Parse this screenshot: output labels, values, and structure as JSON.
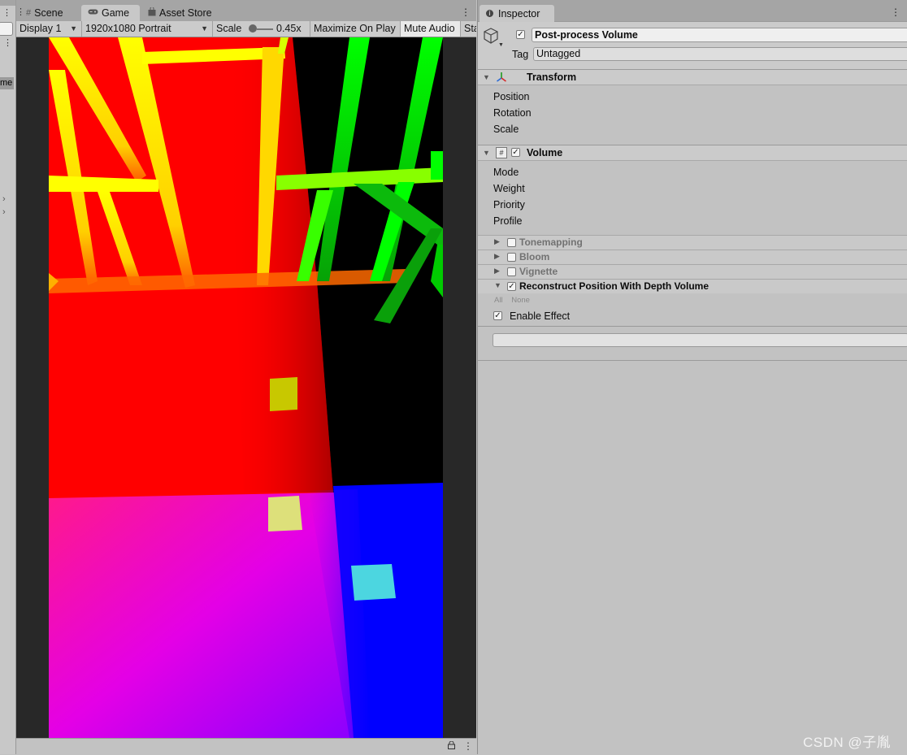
{
  "left_panel": {
    "partial_label": "me"
  },
  "game_window": {
    "tabs": [
      {
        "label": "Scene",
        "icon": "grid-icon",
        "active": false
      },
      {
        "label": "Game",
        "icon": "gamepad-icon",
        "active": true
      },
      {
        "label": "Asset Store",
        "icon": "shopping-bag-icon",
        "active": false
      }
    ],
    "toolbar": {
      "display": "Display 1",
      "resolution": "1920x1080 Portrait",
      "scale_label": "Scale",
      "scale_value": "0.45x",
      "maximize_on_play": "Maximize On Play",
      "mute_audio": "Mute Audio",
      "stats_partial": "Sta"
    }
  },
  "inspector": {
    "tab_label": "Inspector",
    "game_object": {
      "active": true,
      "name": "Post-process Volume",
      "tag_label": "Tag",
      "tag_value": "Untagged"
    },
    "transform": {
      "title": "Transform",
      "properties": [
        "Position",
        "Rotation",
        "Scale"
      ]
    },
    "volume": {
      "enabled": true,
      "title": "Volume",
      "properties": [
        "Mode",
        "Weight",
        "Priority",
        "Profile"
      ]
    },
    "effects": [
      {
        "label": "Tonemapping",
        "enabled": false,
        "expanded": false
      },
      {
        "label": "Bloom",
        "enabled": false,
        "expanded": false
      },
      {
        "label": "Vignette",
        "enabled": false,
        "expanded": false
      },
      {
        "label": "Reconstruct Position With Depth Volume",
        "enabled": true,
        "expanded": true
      }
    ],
    "override_toggles": {
      "all": "All",
      "none": "None"
    },
    "enable_effect": {
      "label": "Enable Effect",
      "checked": true
    }
  },
  "watermark": "CSDN @子胤"
}
